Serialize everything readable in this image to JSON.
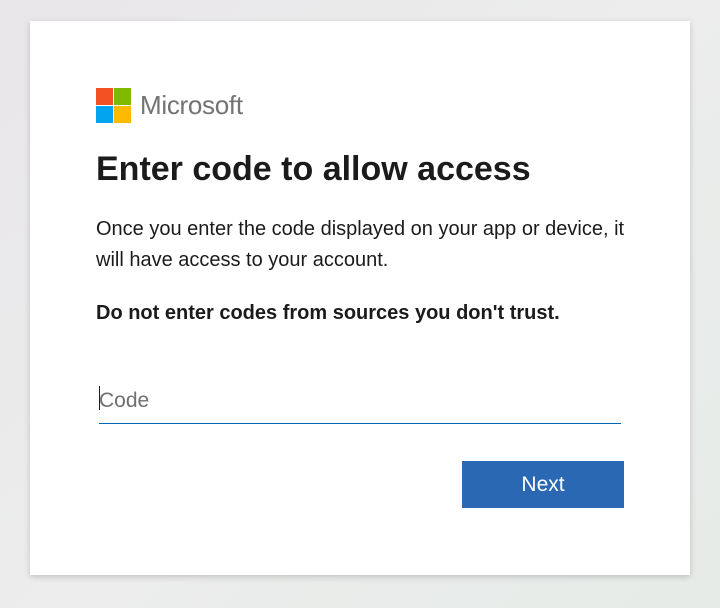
{
  "brand": {
    "name": "Microsoft",
    "logo_colors": [
      "#f25022",
      "#7fba00",
      "#00a4ef",
      "#ffb900"
    ]
  },
  "page": {
    "title": "Enter code to allow access",
    "description": "Once you enter the code displayed on your app or device, it will have access to your account.",
    "warning": "Do not enter codes from sources you don't trust."
  },
  "code_field": {
    "placeholder": "Code",
    "value": ""
  },
  "actions": {
    "next_label": "Next"
  },
  "colors": {
    "accent": "#0067b8",
    "button": "#2a68b3",
    "text": "#1b1b1b",
    "brand_gray": "#737373"
  }
}
